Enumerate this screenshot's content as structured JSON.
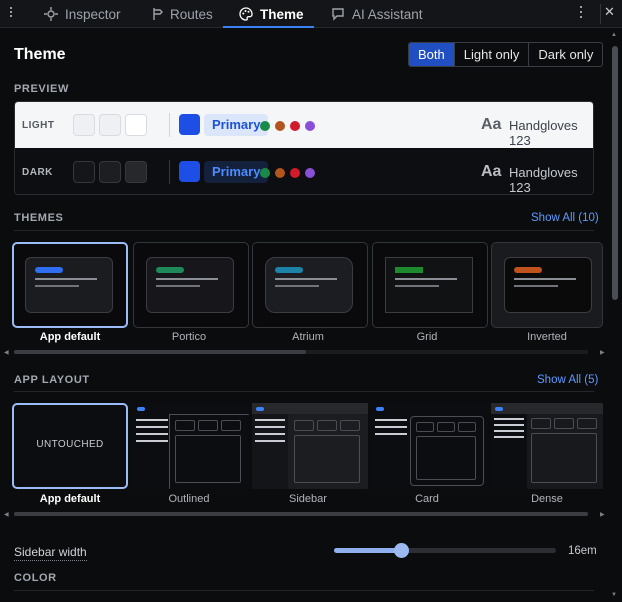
{
  "tabs": [
    {
      "label": "Inspector",
      "icon": "inspector-icon"
    },
    {
      "label": "Routes",
      "icon": "routes-icon"
    },
    {
      "label": "Theme",
      "icon": "palette-icon",
      "active": true
    },
    {
      "label": "AI Assistant",
      "icon": "chat-icon"
    }
  ],
  "header": {
    "title": "Theme",
    "mode_options": [
      "Both",
      "Light only",
      "Dark only"
    ],
    "mode_selected": "Both"
  },
  "preview": {
    "label": "PREVIEW",
    "rows": [
      {
        "label": "LIGHT",
        "chip": "Primary",
        "sample_aa": "Aa",
        "sample_text": "Handgloves 123"
      },
      {
        "label": "DARK",
        "chip": "Primary",
        "sample_aa": "Aa",
        "sample_text": "Handgloves 123"
      }
    ],
    "dot_colors": [
      "#1a8a4a",
      "#b3541e",
      "#d11a2a",
      "#8a4fd8"
    ],
    "primary_color": "#1d4ee6"
  },
  "themes": {
    "label": "THEMES",
    "show_all": "Show All (10)",
    "items": [
      {
        "name": "App default",
        "accent": "#2f6ef0",
        "bg": "#1a1c20",
        "selected": true
      },
      {
        "name": "Portico",
        "accent": "#1e8a5a",
        "bg": "#17161a"
      },
      {
        "name": "Atrium",
        "accent": "#1b84a8",
        "bg": "#1b1d22"
      },
      {
        "name": "Grid",
        "accent": "#1e8a2e",
        "bg": "#111214"
      },
      {
        "name": "Inverted",
        "accent": "#c0521c",
        "bg": "#0a0a0a"
      }
    ]
  },
  "layouts": {
    "label": "APP LAYOUT",
    "show_all": "Show All (5)",
    "untouched": "UNTOUCHED",
    "items": [
      {
        "name": "App default",
        "selected": true
      },
      {
        "name": "Outlined"
      },
      {
        "name": "Sidebar"
      },
      {
        "name": "Card"
      },
      {
        "name": "Dense"
      }
    ]
  },
  "slider": {
    "label": "Sidebar width",
    "value_text": "16em",
    "fraction": 0.3
  },
  "color_section": {
    "label": "COLOR"
  }
}
